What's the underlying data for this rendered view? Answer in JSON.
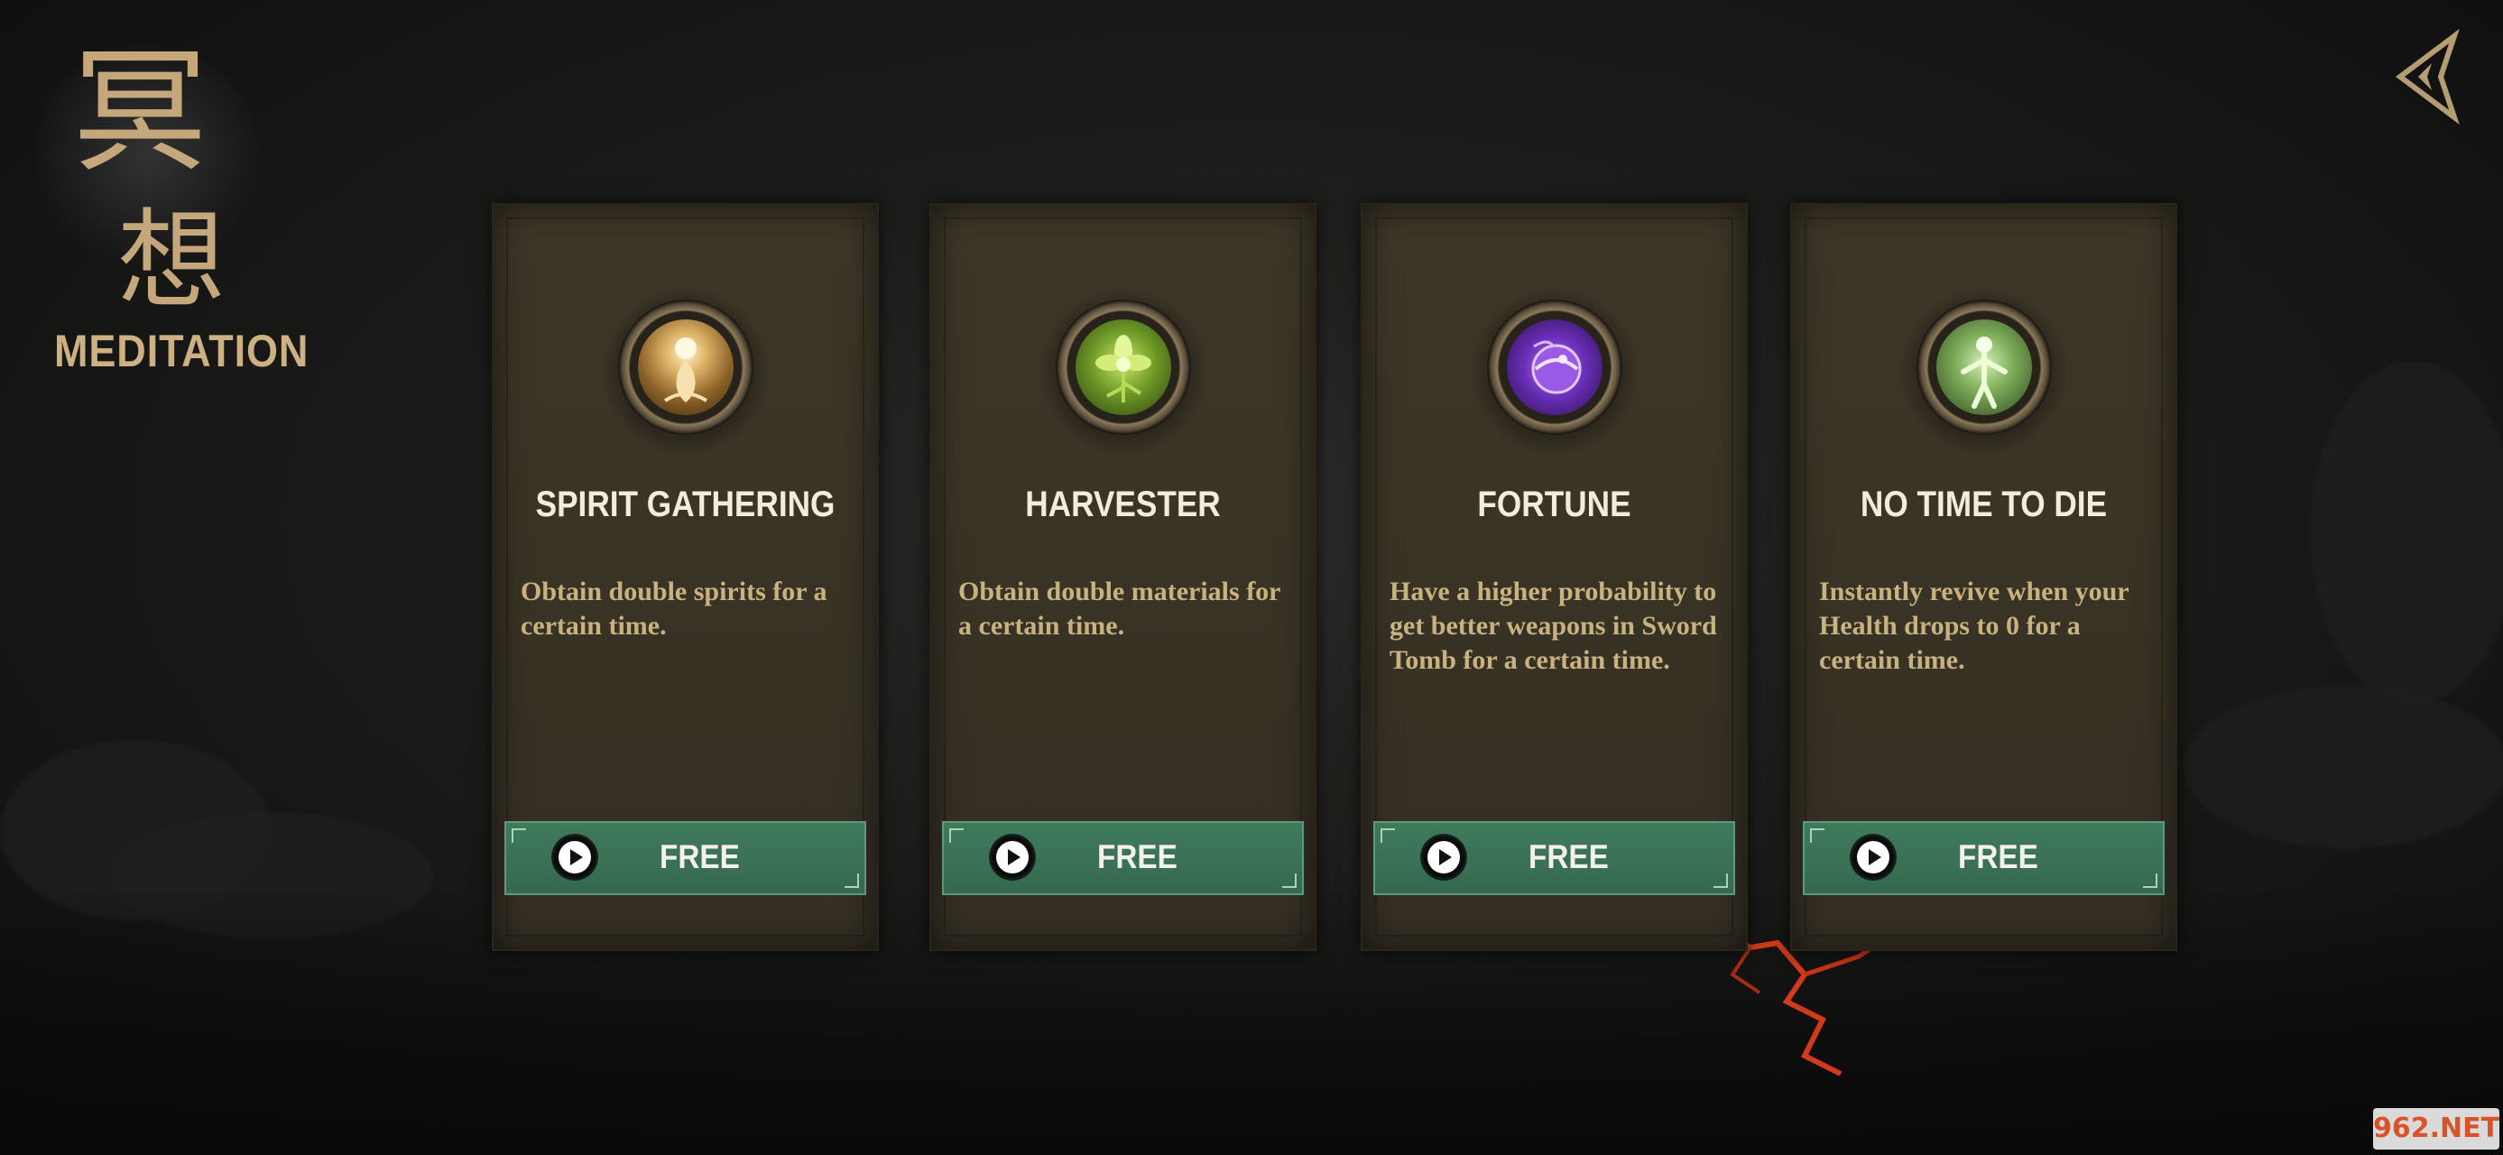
{
  "screen": {
    "title": "MEDITATION",
    "title_kanji_top": "冥",
    "title_kanji_bottom": "想"
  },
  "cards": [
    {
      "title": "SPIRIT GATHERING",
      "description": "Obtain double spirits for a certain time.",
      "button_label": "FREE",
      "icon": "spirit-meditation-icon",
      "icon_color": "#d9a85a"
    },
    {
      "title": "HARVESTER",
      "description": "Obtain double materials for a certain time.",
      "button_label": "FREE",
      "icon": "flower-icon",
      "icon_color": "#9bcb3a"
    },
    {
      "title": "FORTUNE",
      "description": "Have a higher probability to get better weapons in Sword Tomb for a certain time.",
      "button_label": "FREE",
      "icon": "purple-orb-icon",
      "icon_color": "#8a4bd6"
    },
    {
      "title": "NO TIME TO DIE",
      "description": "Instantly revive when your Health drops to 0 for a certain time.",
      "button_label": "FREE",
      "icon": "revive-figure-icon",
      "icon_color": "#9fcf7a"
    }
  ],
  "watermark": "962.NET",
  "colors": {
    "button_green": "#3f7a5c",
    "title_gold": "#cdb183",
    "description_gold": "#c8b27f"
  }
}
